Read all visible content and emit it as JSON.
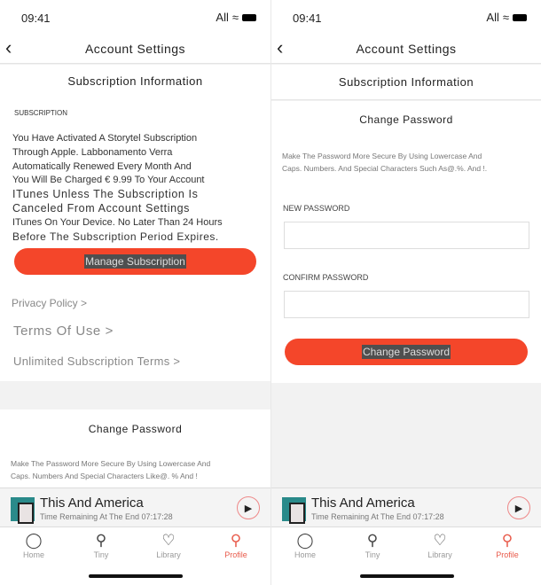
{
  "status": {
    "time": "09:41",
    "signal": "All"
  },
  "header": {
    "title": "Account Settings"
  },
  "subscription": {
    "title": "Subscription Information",
    "label": "SUBSCRIPTION",
    "lines": [
      "You Have Activated A Storytel Subscription",
      "Through Apple. Labbonamento Verra",
      "Automatically Renewed Every Month And",
      "You Will Be Charged € 9.99 To Your Account",
      "ITunes Unless The Subscription Is",
      "Canceled From Account Settings",
      "ITunes On Your Device. No Later Than 24 Hours",
      "Before The Subscription Period Expires."
    ],
    "manage_button": "Manage Subscription",
    "links": [
      "Privacy Policy >",
      "Terms Of Use >",
      "Unlimited Subscription Terms >"
    ]
  },
  "password_left": {
    "title": "Change Password",
    "desc": [
      "Make The Password More Secure By Using Lowercase And",
      "Caps. Numbers And Special Characters Like@. % And !"
    ]
  },
  "password_right": {
    "title": "Change Password",
    "desc": [
      "Make The Password More Secure By Using Lowercase And",
      "Caps. Numbers. And Special Characters Such As@.%. And !."
    ],
    "new_label": "NEW PASSWORD",
    "confirm_label": "CONFIRM PASSWORD",
    "new_value": "",
    "confirm_value": "",
    "button": "Change Password"
  },
  "player": {
    "title": "This And America",
    "subtitle": "Time Remaining At The End 07:17:28"
  },
  "tabs": [
    {
      "label": "Home",
      "icon": "lightbulb-icon"
    },
    {
      "label": "Tiny",
      "icon": "search-icon"
    },
    {
      "label": "Library",
      "icon": "heart-icon"
    },
    {
      "label": "Profile",
      "icon": "person-icon"
    }
  ],
  "colors": {
    "accent": "#f4462a"
  }
}
